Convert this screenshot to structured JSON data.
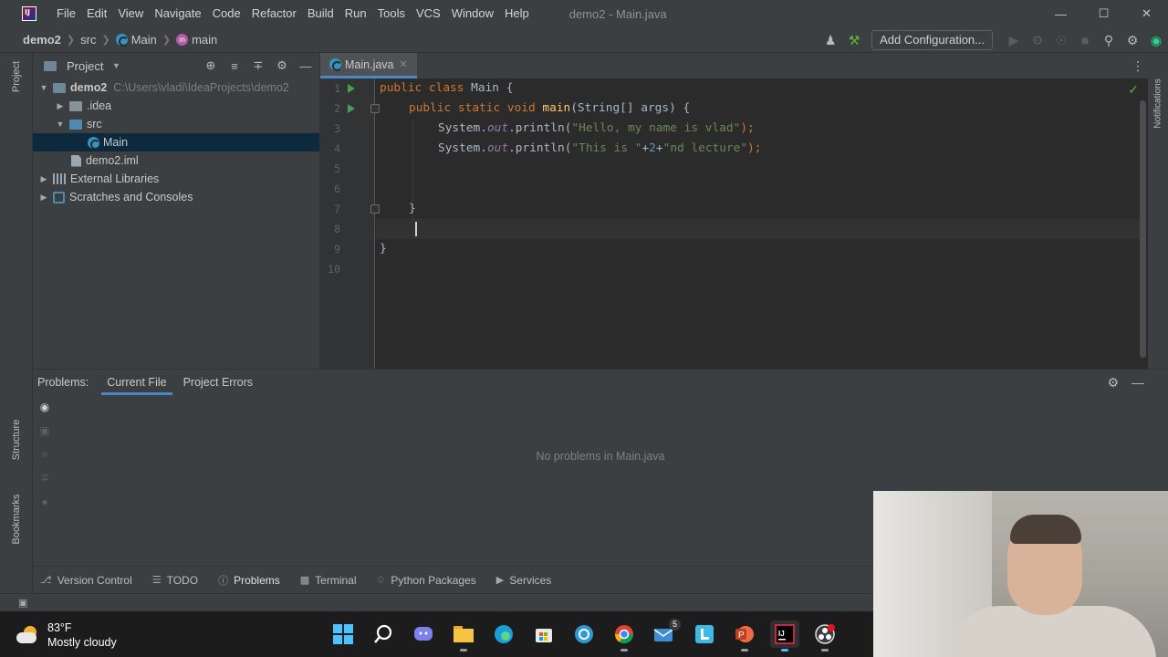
{
  "window": {
    "title": "demo2 - Main.java"
  },
  "menu": [
    "File",
    "Edit",
    "View",
    "Navigate",
    "Code",
    "Refactor",
    "Build",
    "Run",
    "Tools",
    "VCS",
    "Window",
    "Help"
  ],
  "breadcrumb": {
    "project": "demo2",
    "folder": "src",
    "class": "Main",
    "method": "main"
  },
  "toolbar": {
    "add_config_label": "Add Configuration..."
  },
  "project_panel": {
    "title": "Project",
    "tree": [
      {
        "label": "demo2",
        "path": "C:\\Users\\vladi\\IdeaProjects\\demo2"
      },
      {
        "label": ".idea"
      },
      {
        "label": "src"
      },
      {
        "label": "Main"
      },
      {
        "label": "demo2.iml"
      },
      {
        "label": "External Libraries"
      },
      {
        "label": "Scratches and Consoles"
      }
    ]
  },
  "left_strip": {
    "project": "Project",
    "structure": "Structure",
    "bookmarks": "Bookmarks"
  },
  "right_strip": {
    "notifications": "Notifications"
  },
  "editor": {
    "tab_label": "Main.java",
    "line_numbers": [
      "1",
      "2",
      "3",
      "4",
      "5",
      "6",
      "7",
      "8",
      "9",
      "10"
    ],
    "code": {
      "l1_kw": "public class ",
      "l1_name": "Main {",
      "l2_kw": "public static void ",
      "l2_fn": "main",
      "l2_rest": "(String[] args) {",
      "l3_sys": "System.",
      "l3_out": "out",
      "l3_call": ".println(",
      "l3_str": "\"Hello, my name is vlad\"",
      "l3_end": ");",
      "l4_sys": "System.",
      "l4_out": "out",
      "l4_call": ".println(",
      "l4_str1": "\"This is \"",
      "l4_plus1": "+",
      "l4_num": "2",
      "l4_plus2": "+",
      "l4_str2": "\"nd lecture\"",
      "l4_end": ");",
      "l7": "}",
      "l9": "}"
    }
  },
  "problems": {
    "label": "Problems:",
    "tabs": [
      "Current File",
      "Project Errors"
    ],
    "empty_message": "No problems in Main.java"
  },
  "bottom_tools": [
    "Version Control",
    "TODO",
    "Problems",
    "Terminal",
    "Python Packages",
    "Services"
  ],
  "taskbar": {
    "weather_temp": "83°F",
    "weather_desc": "Mostly cloudy",
    "mail_badge": "5"
  },
  "colors": {
    "keyword": "#cc7832",
    "string": "#6a8759",
    "function": "#ffc66d",
    "field": "#9876aa",
    "number": "#6897bb",
    "accent": "#4a88c7"
  }
}
